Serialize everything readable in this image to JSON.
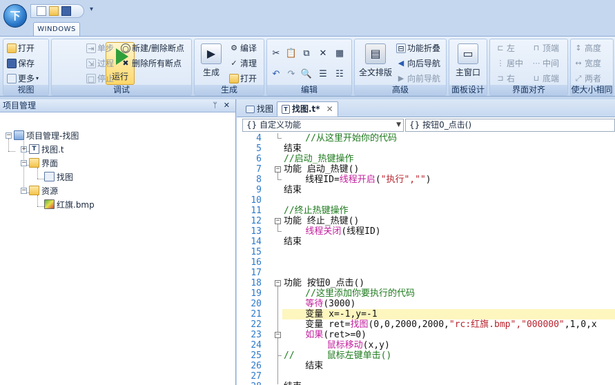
{
  "app": {
    "orb_label": "下"
  },
  "ribbon_tab": "WINDOWS",
  "groups": {
    "view": {
      "label": "视图",
      "open": "打开",
      "save": "保存",
      "more": "更多"
    },
    "debug": {
      "label": "调试",
      "run": "运行",
      "step": "单步",
      "proc": "过程",
      "stop": "停止",
      "toggle_bp": "新建/删除断点",
      "del_bp": "删除所有断点"
    },
    "build": {
      "label": "生成",
      "build": "生成",
      "compile": "编译",
      "clean": "清理",
      "open": "打开"
    },
    "edit": {
      "label": "编辑"
    },
    "advanced": {
      "label": "高级",
      "layout": "全文排版",
      "fold": "功能折叠",
      "nav_back": "向后导航",
      "nav_fwd": "向前导航"
    },
    "panel_design": {
      "label": "面板设计",
      "main_window": "主窗口"
    },
    "align": {
      "label": "界面对齐",
      "left": "左",
      "top": "顶端",
      "center": "居中",
      "middle": "中间",
      "right": "右",
      "bottom": "底端"
    },
    "size": {
      "label": "使大小相同",
      "height": "高度",
      "width": "宽度",
      "both": "两者"
    }
  },
  "project_panel": {
    "title": "项目管理",
    "tree": {
      "root": "项目管理-找图",
      "file": "找图.t",
      "folder_ui": "界面",
      "form": "找图",
      "folder_res": "资源",
      "resource": "红旗.bmp"
    }
  },
  "editor": {
    "tabs": [
      "找图",
      "找图.t*"
    ],
    "func_dropdown": "{} 自定义功能",
    "proc_dropdown": "{} 按钮0_点击()"
  },
  "code": {
    "lines": [
      {
        "n": "4",
        "t": "    //从这里开始你的代码"
      },
      {
        "n": "5",
        "t": "结束"
      },
      {
        "n": "6",
        "t": "//启动_热键操作"
      },
      {
        "n": "7",
        "t": "功能 启动_热键()"
      },
      {
        "n": "8",
        "a": "    线程ID=",
        "b": "线程开启",
        "c": "(",
        "d": "\"执行\",\"\"",
        "e": ")"
      },
      {
        "n": "9",
        "t": "结束"
      },
      {
        "n": "10",
        "t": ""
      },
      {
        "n": "11",
        "t": "//终止热键操作"
      },
      {
        "n": "12",
        "t": "功能 终止_热键()"
      },
      {
        "n": "13",
        "a": "    ",
        "b": "线程关闭",
        "c": "(线程ID)"
      },
      {
        "n": "14",
        "t": "结束"
      },
      {
        "n": "15",
        "t": ""
      },
      {
        "n": "16",
        "t": ""
      },
      {
        "n": "17",
        "t": ""
      },
      {
        "n": "18",
        "t": "功能 按钮0_点击()"
      },
      {
        "n": "19",
        "t": "    //这里添加你要执行的代码"
      },
      {
        "n": "20",
        "a": "    ",
        "b": "等待",
        "c": "(3000)"
      },
      {
        "n": "21",
        "t": "    变量 x=-1,y=-1"
      },
      {
        "n": "22",
        "a": "    变量 ret=",
        "b": "找图",
        "c": "(0,0,2000,2000,",
        "d": "\"rc:红旗.bmp\",\"000000\"",
        "e": ",1,0,x"
      },
      {
        "n": "23",
        "a": "    ",
        "b": "如果",
        "c": "(ret>=0)"
      },
      {
        "n": "24",
        "a": "        ",
        "b": "鼠标移动",
        "c": "(x,y)"
      },
      {
        "n": "25",
        "t": "//      鼠标左键单击()"
      },
      {
        "n": "26",
        "t": "    结束"
      },
      {
        "n": "27",
        "t": ""
      },
      {
        "n": "28",
        "t": "结束"
      }
    ]
  }
}
